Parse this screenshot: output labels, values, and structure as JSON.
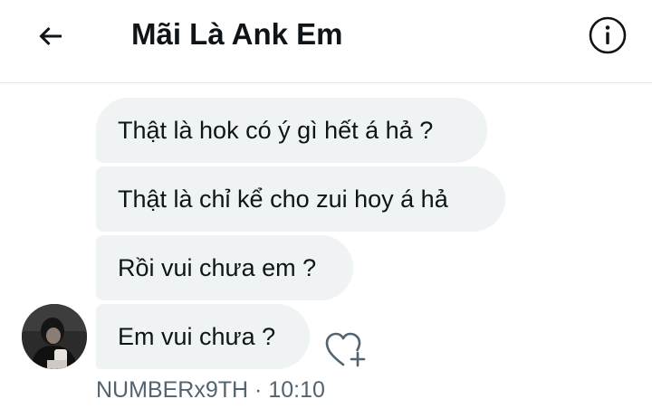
{
  "header": {
    "title": "Mãi Là Ank Em",
    "back_icon": "arrow-left-icon",
    "info_icon": "info-circle-icon"
  },
  "messages": [
    {
      "text": "Thật là hok có ý gì hết á hả ?"
    },
    {
      "text": "Thật là chỉ kể cho zui hoy á hả"
    },
    {
      "text": "Rồi vui chưa em ?"
    },
    {
      "text": "Em vui chưa ?"
    }
  ],
  "reaction": {
    "icon": "heart-plus-icon"
  },
  "meta": {
    "sender": "NUMBERx9TH",
    "separator": "·",
    "time": "10:10"
  },
  "colors": {
    "bubble_bg": "#eff3f4",
    "text": "#0f1419",
    "secondary_text": "#536471",
    "divider": "#dfe6ea"
  }
}
